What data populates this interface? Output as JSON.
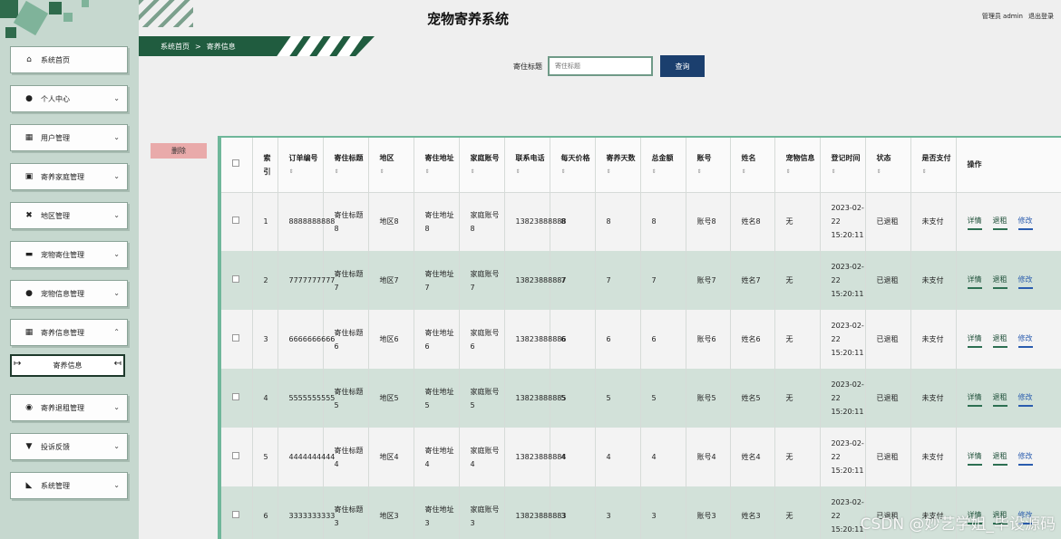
{
  "header": {
    "title": "宠物寄养系统",
    "user": "管理员 admin",
    "logout": "退出登录"
  },
  "breadcrumb": {
    "home": "系统首页",
    "separator": ">",
    "current": "寄养信息"
  },
  "search": {
    "label": "寄住标题",
    "placeholder": "寄住标题",
    "button": "查询"
  },
  "actions": {
    "delete": "删除"
  },
  "sidebar": {
    "items": [
      {
        "label": "系统首页",
        "icon": "⌂",
        "icon_name": "home-icon",
        "chevron": ""
      },
      {
        "label": "个人中心",
        "icon": "●",
        "icon_name": "user-icon",
        "chevron": "⌄"
      },
      {
        "label": "用户管理",
        "icon": "▦",
        "icon_name": "grid-icon",
        "chevron": "⌄"
      },
      {
        "label": "寄养家庭管理",
        "icon": "▣",
        "icon_name": "clipboard-icon",
        "chevron": "⌄"
      },
      {
        "label": "地区管理",
        "icon": "✖",
        "icon_name": "map-icon",
        "chevron": "⌄"
      },
      {
        "label": "宠物寄住管理",
        "icon": "▬",
        "icon_name": "monitor-icon",
        "chevron": "⌄"
      },
      {
        "label": "宠物信息管理",
        "icon": "●",
        "icon_name": "user-icon",
        "chevron": "⌄"
      },
      {
        "label": "寄养信息管理",
        "icon": "▦",
        "icon_name": "grid-icon",
        "chevron": "⌃"
      },
      {
        "label": "寄养退租管理",
        "icon": "◉",
        "icon_name": "location-icon",
        "chevron": "⌄"
      },
      {
        "label": "投诉反馈",
        "icon": "▼",
        "icon_name": "funnel-icon",
        "chevron": "⌄"
      },
      {
        "label": "系统管理",
        "icon": "◣",
        "icon_name": "chart-icon",
        "chevron": "⌄"
      }
    ],
    "submenu": {
      "label": "寄养信息"
    }
  },
  "table": {
    "columns": [
      "",
      "索引",
      "订单编号",
      "寄住标题",
      "地区",
      "寄住地址",
      "家庭账号",
      "联系电话",
      "每天价格",
      "寄养天数",
      "总金额",
      "账号",
      "姓名",
      "宠物信息",
      "登记时间",
      "状态",
      "是否支付",
      "操作"
    ],
    "rows": [
      [
        "",
        "1",
        "8888888888",
        "寄住标题8",
        "地区8",
        "寄住地址8",
        "家庭账号8",
        "13823888888",
        "8",
        "8",
        "8",
        "账号8",
        "姓名8",
        "无",
        "2023-02-22 15:20:11",
        "已退租",
        "未支付",
        ""
      ],
      [
        "",
        "2",
        "7777777777",
        "寄住标题7",
        "地区7",
        "寄住地址7",
        "家庭账号7",
        "13823888887",
        "7",
        "7",
        "7",
        "账号7",
        "姓名7",
        "无",
        "2023-02-22 15:20:11",
        "已退租",
        "未支付",
        ""
      ],
      [
        "",
        "3",
        "6666666666",
        "寄住标题6",
        "地区6",
        "寄住地址6",
        "家庭账号6",
        "13823888886",
        "6",
        "6",
        "6",
        "账号6",
        "姓名6",
        "无",
        "2023-02-22 15:20:11",
        "已退租",
        "未支付",
        ""
      ],
      [
        "",
        "4",
        "5555555555",
        "寄住标题5",
        "地区5",
        "寄住地址5",
        "家庭账号5",
        "13823888885",
        "5",
        "5",
        "5",
        "账号5",
        "姓名5",
        "无",
        "2023-02-22 15:20:11",
        "已退租",
        "未支付",
        ""
      ],
      [
        "",
        "5",
        "4444444444",
        "寄住标题4",
        "地区4",
        "寄住地址4",
        "家庭账号4",
        "13823888884",
        "4",
        "4",
        "4",
        "账号4",
        "姓名4",
        "无",
        "2023-02-22 15:20:11",
        "已退租",
        "未支付",
        ""
      ],
      [
        "",
        "6",
        "3333333333",
        "寄住标题3",
        "地区3",
        "寄住地址3",
        "家庭账号3",
        "13823888883",
        "3",
        "3",
        "3",
        "账号3",
        "姓名3",
        "无",
        "2023-02-22 15:20:11",
        "已退租",
        "未支付",
        ""
      ]
    ],
    "row_actions": [
      "详情",
      "退租",
      "修改"
    ]
  },
  "watermark": "CSDN @妙艺学姐_毕设源码"
}
